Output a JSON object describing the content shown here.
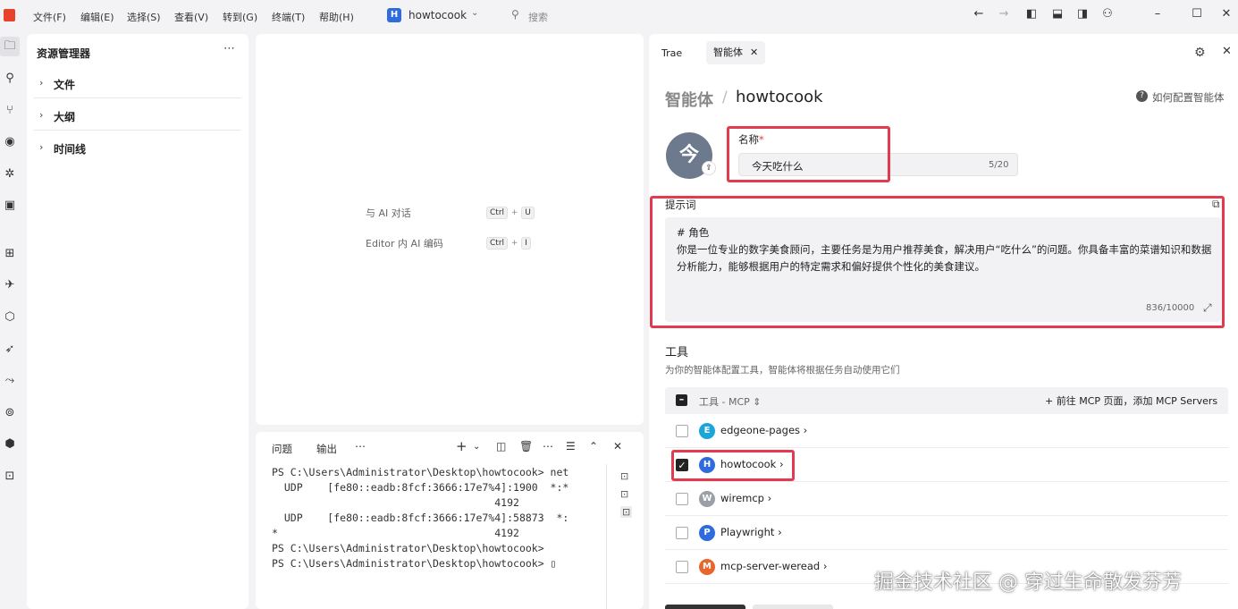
{
  "titlebar": {
    "menus": [
      "文件(F)",
      "编辑(E)",
      "选择(S)",
      "查看(V)",
      "转到(G)",
      "终端(T)",
      "帮助(H)"
    ],
    "project_badge": "H",
    "project_name": "howtocook",
    "search_placeholder": "搜索",
    "accent": "#e8412c"
  },
  "explorer": {
    "title": "资源管理器",
    "sections": [
      "文件",
      "大纲",
      "时间线"
    ]
  },
  "editor": {
    "hints": [
      {
        "label": "与 AI 对话",
        "keys": [
          "Ctrl",
          "U"
        ]
      },
      {
        "label": "Editor 内 AI 编码",
        "keys": [
          "Ctrl",
          "I"
        ]
      }
    ]
  },
  "terminal": {
    "tabs": [
      "问题",
      "输出"
    ],
    "lines": [
      "PS C:\\Users\\Administrator\\Desktop\\howtocook> net",
      "  UDP    [fe80::eadb:8fcf:3666:17e7%4]:1900  *:*",
      "                                    4192",
      "  UDP    [fe80::eadb:8fcf:3666:17e7%4]:58873  *:",
      "*                                   4192",
      "PS C:\\Users\\Administrator\\Desktop\\howtocook>",
      "PS C:\\Users\\Administrator\\Desktop\\howtocook> ▯"
    ]
  },
  "agent": {
    "tab_trae": "Trae",
    "tab_agent": "智能体",
    "breadcrumb_root": "智能体",
    "breadcrumb_sep": "/",
    "breadcrumb_name": "howtocook",
    "help_text": "如何配置智能体",
    "avatar_char": "今",
    "name_label": "名称",
    "name_required": "*",
    "name_value": "今天吃什么",
    "name_count": "5/20",
    "prompt_label": "提示词",
    "prompt_text": "# 角色\n你是一位专业的数字美食顾问，主要任务是为用户推荐美食，解决用户“吃什么”的问题。你具备丰富的菜谱知识和数据分析能力，能够根据用户的特定需求和偏好提供个性化的美食建议。",
    "prompt_count": "836/10000",
    "tools_title": "工具",
    "tools_desc": "为你的智能体配置工具，智能体将根据任务自动使用它们",
    "tools_header_label": "工具 - MCP ⇕",
    "tools_add": "+  前往 MCP 页面，添加 MCP Servers",
    "tools": [
      {
        "initial": "E",
        "name": "edgeone-pages ›",
        "checked": false,
        "color": "#1aa6d8"
      },
      {
        "initial": "H",
        "name": "howtocook ›",
        "checked": true,
        "color": "#2e6bdc"
      },
      {
        "initial": "W",
        "name": "wiremcp ›",
        "checked": false,
        "color": "#9aa0a6"
      },
      {
        "initial": "P",
        "name": "Playwright ›",
        "checked": false,
        "color": "#2e6bdc"
      },
      {
        "initial": "M",
        "name": "mcp-server-weread ›",
        "checked": false,
        "color": "#e8662c"
      }
    ],
    "highlight_color": "#e23a4e"
  },
  "watermark": "掘金技术社区 @ 穿过生命散发芬芳"
}
